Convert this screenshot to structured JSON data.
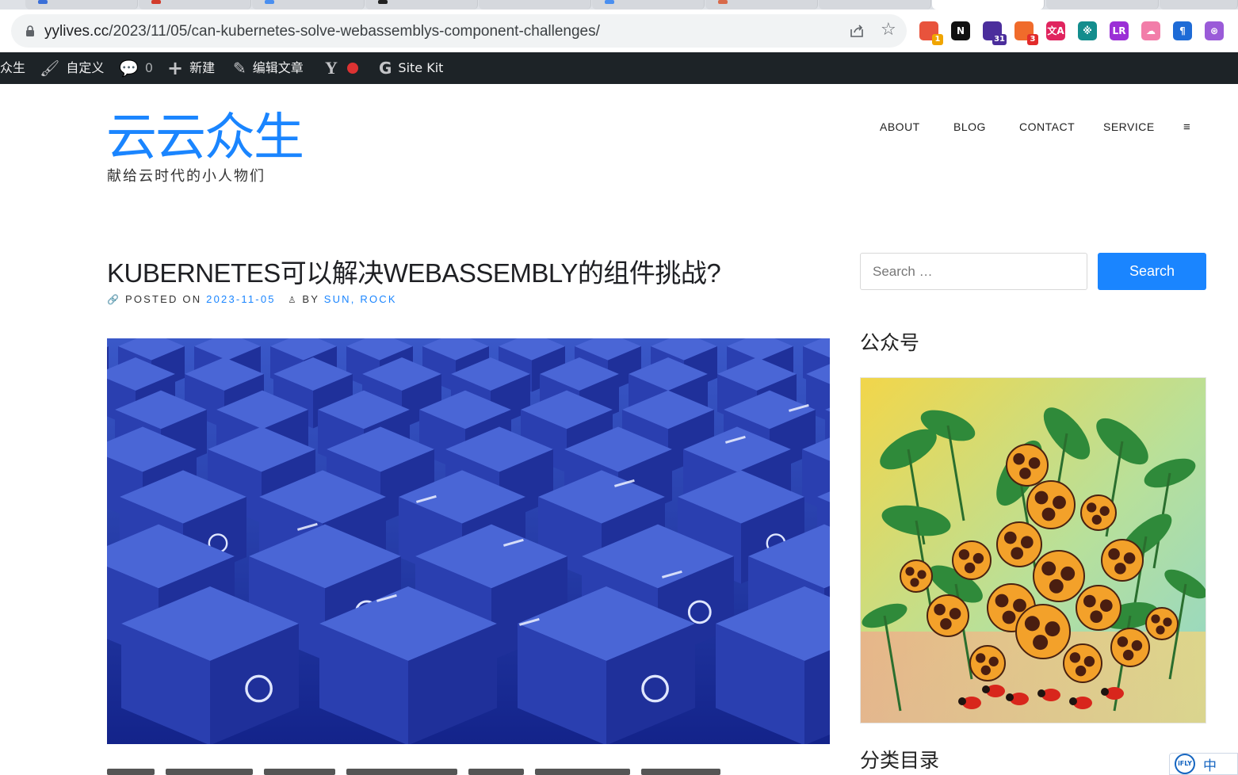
{
  "browser": {
    "url_host": "yylives.cc",
    "url_path": "/2023/11/05/can-kubernetes-solve-webassemblys-component-challenges/",
    "extensions": [
      {
        "name": "ext-1",
        "color": "#e8533c",
        "badge": "1",
        "badge_color": "#f0a500"
      },
      {
        "name": "notion",
        "color": "#111111",
        "glyph": "N"
      },
      {
        "name": "ext-3",
        "color": "#4b2e9c",
        "badge": "31",
        "badge_color": "#4b2e9c"
      },
      {
        "name": "ext-4",
        "color": "#f06b2b",
        "badge": "3",
        "badge_color": "#e22b2b"
      },
      {
        "name": "ext-5",
        "color": "#e0245e",
        "glyph": "文A"
      },
      {
        "name": "ext-6",
        "color": "#138d8d",
        "glyph": "※"
      },
      {
        "name": "ext-7",
        "color": "#9b2fd6",
        "glyph": "LR"
      },
      {
        "name": "ext-8",
        "color": "#f27da9",
        "glyph": "☁"
      },
      {
        "name": "ext-9",
        "color": "#1e6bd6",
        "glyph": "¶"
      },
      {
        "name": "chatgpt",
        "color": "#9a5bd8",
        "glyph": "⊛"
      }
    ]
  },
  "adminbar": {
    "site_name": "众生",
    "customize": "自定义",
    "comments": "0",
    "new": "新建",
    "edit": "编辑文章",
    "sitekit": "Site Kit"
  },
  "site": {
    "title": "云云众生",
    "description": "献给云时代的小人物们"
  },
  "nav": [
    "ABOUT",
    "BLOG",
    "CONTACT",
    "SERVICE",
    "≡"
  ],
  "post": {
    "title": "KUBERNETES可以解决WEBASSEMBLY的组件挑战?",
    "posted_on_label": "POSTED ON",
    "date": "2023-11-05",
    "by_label": "BY",
    "author": "SUN, ROCK"
  },
  "sidebar": {
    "search_placeholder": "Search …",
    "search_button": "Search",
    "widget1_title": "公众号",
    "widget2_title": "分类目录"
  },
  "ime": {
    "logo": "iFLY",
    "lang": "中"
  }
}
